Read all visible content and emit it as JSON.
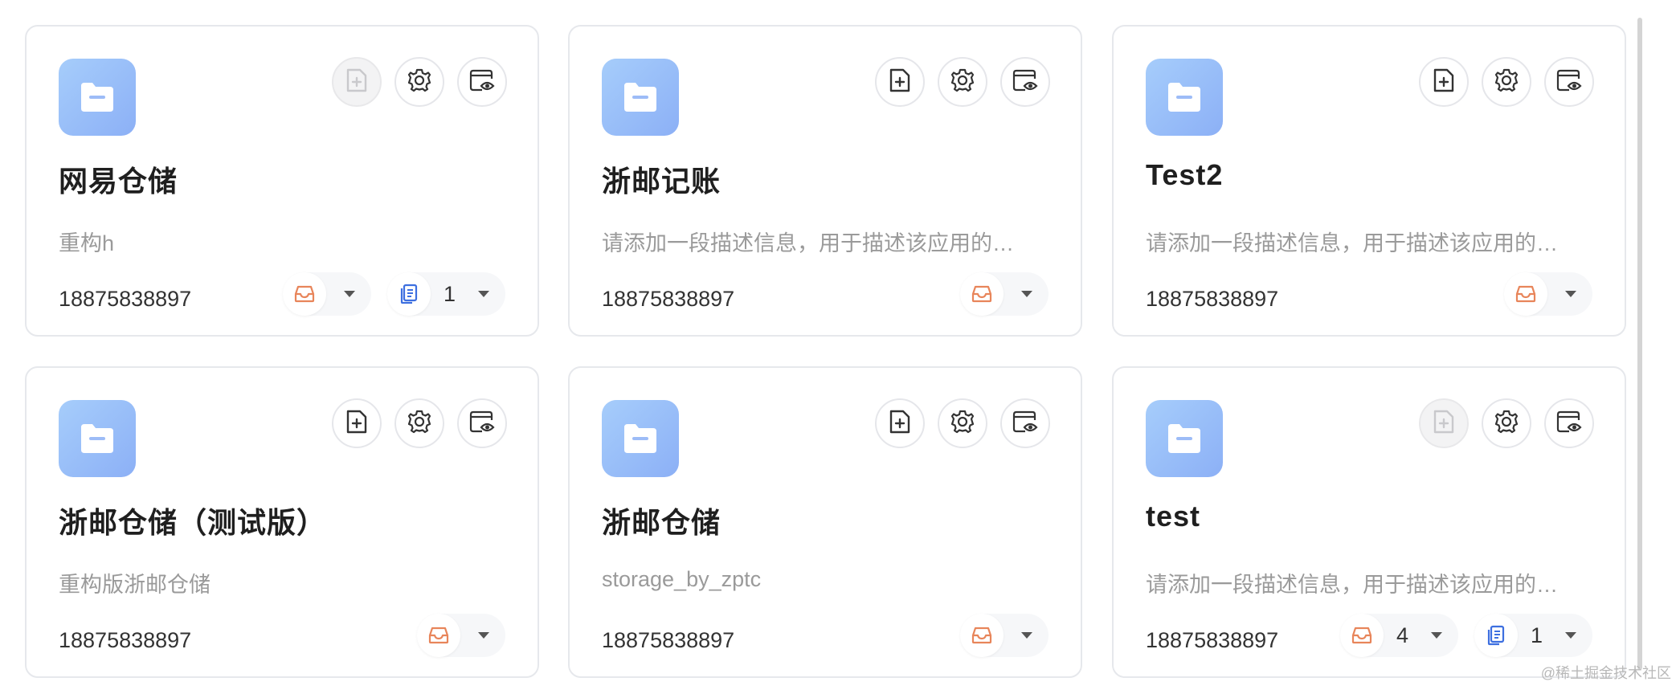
{
  "cards": [
    {
      "title": "网易仓储",
      "description": "重构h",
      "owner": "18875838897",
      "create_disabled": true,
      "pills": [
        {
          "icon": "inbox-icon",
          "count": ""
        },
        {
          "icon": "document-icon",
          "count": "1"
        }
      ]
    },
    {
      "title": "浙邮记账",
      "description": "请添加一段描述信息，用于描述该应用的…",
      "owner": "18875838897",
      "create_disabled": false,
      "pills": [
        {
          "icon": "inbox-icon",
          "count": ""
        }
      ]
    },
    {
      "title": "Test2",
      "description": "请添加一段描述信息，用于描述该应用的…",
      "owner": "18875838897",
      "create_disabled": false,
      "pills": [
        {
          "icon": "inbox-icon",
          "count": ""
        }
      ]
    },
    {
      "title": "浙邮仓储（测试版）",
      "description": "重构版浙邮仓储",
      "owner": "18875838897",
      "create_disabled": false,
      "pills": [
        {
          "icon": "inbox-icon",
          "count": ""
        }
      ]
    },
    {
      "title": "浙邮仓储",
      "description": "storage_by_zptc",
      "owner": "18875838897",
      "create_disabled": false,
      "pills": [
        {
          "icon": "inbox-icon",
          "count": ""
        }
      ]
    },
    {
      "title": "test",
      "description": "请添加一段描述信息，用于描述该应用的…",
      "owner": "18875838897",
      "create_disabled": true,
      "pills": [
        {
          "icon": "inbox-icon",
          "count": "4"
        },
        {
          "icon": "document-icon",
          "count": "1"
        }
      ]
    }
  ],
  "icons": {
    "app": "folder-icon",
    "actions": [
      "add-file-icon",
      "gear-icon",
      "preview-window-icon"
    ]
  },
  "colors": {
    "inbox_icon": "#e8855a",
    "document_icon": "#3d6fe0",
    "app_icon_gradient": [
      "#a6cdfb",
      "#8cb0f6"
    ]
  },
  "watermark": "@稀土掘金技术社区"
}
